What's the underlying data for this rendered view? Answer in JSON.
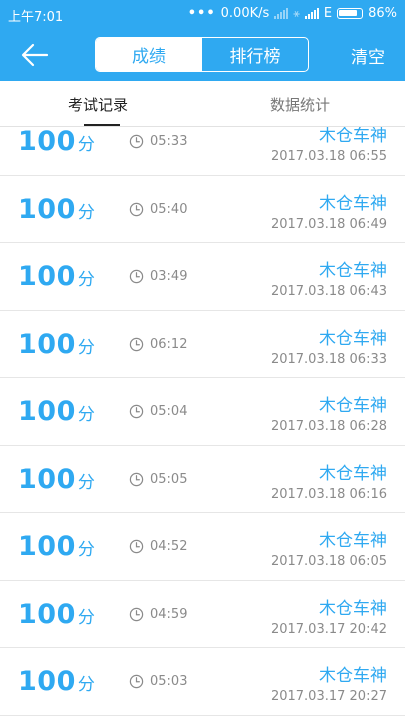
{
  "status": {
    "time": "上午7:01",
    "dots": "•••",
    "speed": "0.00K/s",
    "network": "E",
    "battery": "86%"
  },
  "header": {
    "segments": [
      "成绩",
      "排行榜"
    ],
    "active_segment": 0,
    "clear_label": "清空"
  },
  "tabs": {
    "items": [
      "考试记录",
      "数据统计"
    ],
    "active": 0
  },
  "records": [
    {
      "score": "100",
      "unit": "分",
      "duration": "05:33",
      "name": "木仓车神",
      "date": "2017.03.18  06:55"
    },
    {
      "score": "100",
      "unit": "分",
      "duration": "05:40",
      "name": "木仓车神",
      "date": "2017.03.18  06:49"
    },
    {
      "score": "100",
      "unit": "分",
      "duration": "03:49",
      "name": "木仓车神",
      "date": "2017.03.18  06:43"
    },
    {
      "score": "100",
      "unit": "分",
      "duration": "06:12",
      "name": "木仓车神",
      "date": "2017.03.18  06:33"
    },
    {
      "score": "100",
      "unit": "分",
      "duration": "05:04",
      "name": "木仓车神",
      "date": "2017.03.18  06:28"
    },
    {
      "score": "100",
      "unit": "分",
      "duration": "05:05",
      "name": "木仓车神",
      "date": "2017.03.18  06:16"
    },
    {
      "score": "100",
      "unit": "分",
      "duration": "04:52",
      "name": "木仓车神",
      "date": "2017.03.18  06:05"
    },
    {
      "score": "100",
      "unit": "分",
      "duration": "04:59",
      "name": "木仓车神",
      "date": "2017.03.17  20:42"
    },
    {
      "score": "100",
      "unit": "分",
      "duration": "05:03",
      "name": "木仓车神",
      "date": "2017.03.17  20:27"
    }
  ],
  "colors": {
    "accent": "#2fa9f1",
    "muted_text": "#8a8a8a",
    "divider": "#e6e6e6"
  },
  "icons": {
    "back": "arrow-left-icon",
    "duration": "clock-icon"
  }
}
